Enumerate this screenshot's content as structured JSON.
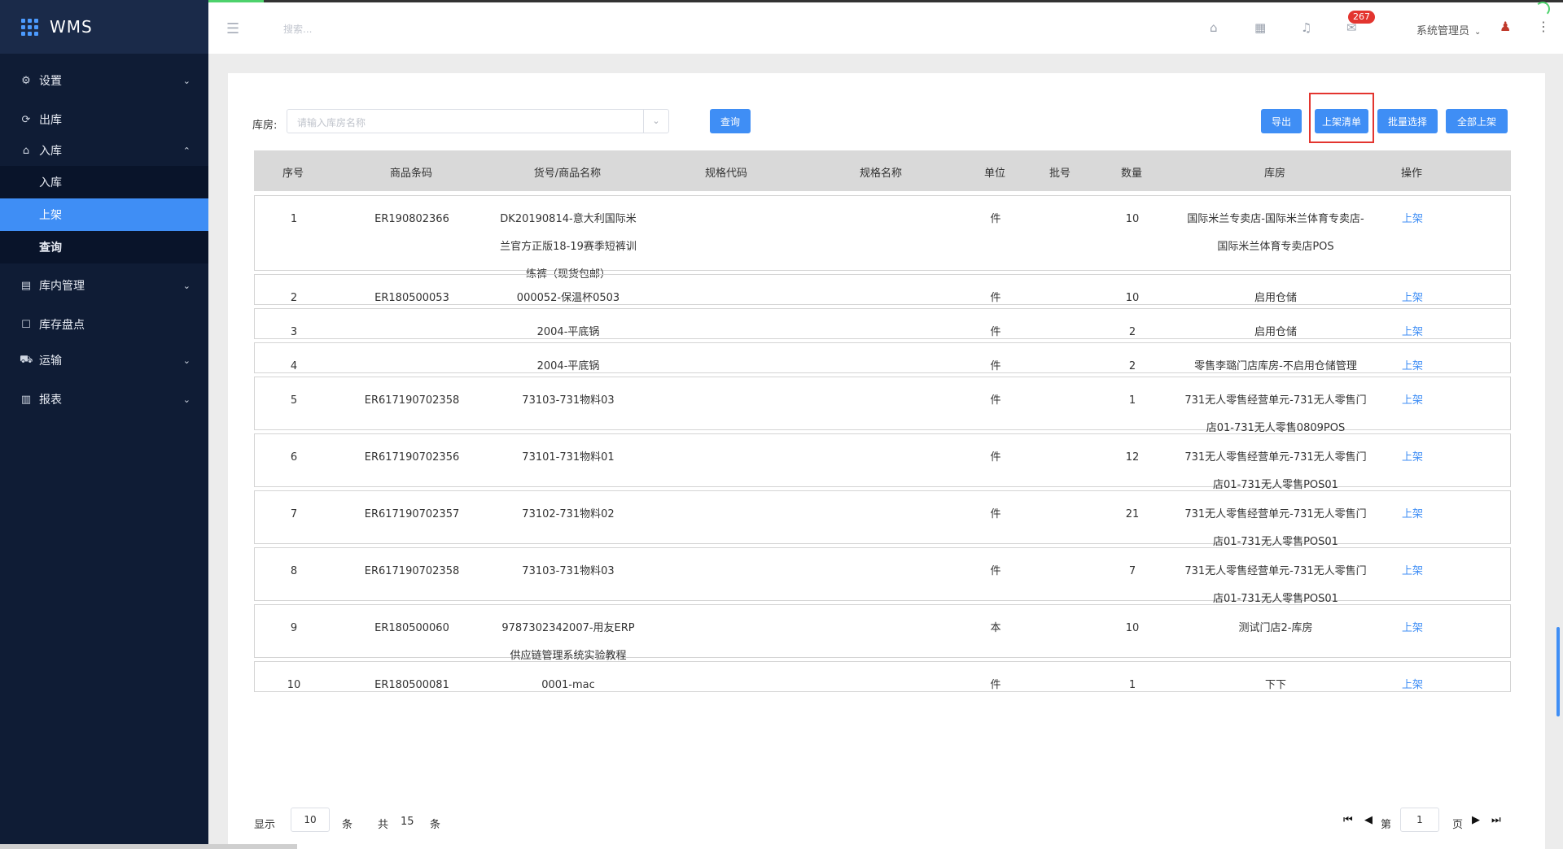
{
  "app": {
    "title": "WMS"
  },
  "sidebar": {
    "items": [
      {
        "label": "设置",
        "icon": "gear-icon",
        "expanded": false
      },
      {
        "label": "出库",
        "icon": "export-icon"
      },
      {
        "label": "入库",
        "icon": "home-icon",
        "expanded": true,
        "children": [
          {
            "label": "入库",
            "active": false
          },
          {
            "label": "上架",
            "active": true
          },
          {
            "label": "查询",
            "active": false
          }
        ]
      },
      {
        "label": "库内管理",
        "icon": "warehouse-icon",
        "expanded": false
      },
      {
        "label": "库存盘点",
        "icon": "clipboard-icon"
      },
      {
        "label": "运输",
        "icon": "truck-icon",
        "expanded": false
      },
      {
        "label": "报表",
        "icon": "chart-icon",
        "expanded": false
      }
    ]
  },
  "header": {
    "search_placeholder": "搜索...",
    "badge_count": "267",
    "user_name": "系统管理员"
  },
  "filter": {
    "label": "库房:",
    "placeholder": "请输入库房名称",
    "query_button": "查询"
  },
  "actions": {
    "export": "导出",
    "shelf_list": "上架清单",
    "batch_select": "批量选择",
    "shelve_all": "全部上架"
  },
  "table": {
    "columns": [
      "序号",
      "商品条码",
      "货号/商品名称",
      "规格代码",
      "规格名称",
      "单位",
      "批号",
      "数量",
      "库房",
      "操作"
    ],
    "rows": [
      {
        "no": "1",
        "barcode": "ER190802366",
        "name": "DK20190814-意大利国际米兰官方正版18-19赛季短裤训练裤（现货包邮）",
        "spec_code": "",
        "spec_name": "",
        "unit": "件",
        "batch": "",
        "qty": "10",
        "warehouse": "国际米兰专卖店-国际米兰体育专卖店-国际米兰体育专卖店POS",
        "op": "上架"
      },
      {
        "no": "2",
        "barcode": "ER180500053",
        "name": "000052-保温杯0503",
        "spec_code": "",
        "spec_name": "",
        "unit": "件",
        "batch": "",
        "qty": "10",
        "warehouse": "启用仓储",
        "op": "上架"
      },
      {
        "no": "3",
        "barcode": "",
        "name": "2004-平底锅",
        "spec_code": "",
        "spec_name": "",
        "unit": "件",
        "batch": "",
        "qty": "2",
        "warehouse": "启用仓储",
        "op": "上架"
      },
      {
        "no": "4",
        "barcode": "",
        "name": "2004-平底锅",
        "spec_code": "",
        "spec_name": "",
        "unit": "件",
        "batch": "",
        "qty": "2",
        "warehouse": "零售李璐门店库房-不启用仓储管理",
        "op": "上架"
      },
      {
        "no": "5",
        "barcode": "ER617190702358",
        "name": "73103-731物料03",
        "spec_code": "",
        "spec_name": "",
        "unit": "件",
        "batch": "",
        "qty": "1",
        "warehouse": "731无人零售经营单元-731无人零售门店01-731无人零售0809POS",
        "op": "上架"
      },
      {
        "no": "6",
        "barcode": "ER617190702356",
        "name": "73101-731物料01",
        "spec_code": "",
        "spec_name": "",
        "unit": "件",
        "batch": "",
        "qty": "12",
        "warehouse": "731无人零售经营单元-731无人零售门店01-731无人零售POS01",
        "op": "上架"
      },
      {
        "no": "7",
        "barcode": "ER617190702357",
        "name": "73102-731物料02",
        "spec_code": "",
        "spec_name": "",
        "unit": "件",
        "batch": "",
        "qty": "21",
        "warehouse": "731无人零售经营单元-731无人零售门店01-731无人零售POS01",
        "op": "上架"
      },
      {
        "no": "8",
        "barcode": "ER617190702358",
        "name": "73103-731物料03",
        "spec_code": "",
        "spec_name": "",
        "unit": "件",
        "batch": "",
        "qty": "7",
        "warehouse": "731无人零售经营单元-731无人零售门店01-731无人零售POS01",
        "op": "上架"
      },
      {
        "no": "9",
        "barcode": "ER180500060",
        "name": "9787302342007-用友ERP供应链管理系统实验教程",
        "spec_code": "",
        "spec_name": "",
        "unit": "本",
        "batch": "",
        "qty": "10",
        "warehouse": "测试门店2-库房",
        "op": "上架"
      },
      {
        "no": "10",
        "barcode": "ER180500081",
        "name": "0001-mac",
        "spec_code": "",
        "spec_name": "",
        "unit": "件",
        "batch": "",
        "qty": "1",
        "warehouse": "下下",
        "op": "上架"
      }
    ]
  },
  "pagination": {
    "show_label": "显示",
    "page_size": "10",
    "unit": "条",
    "total_label": "共",
    "total": "15",
    "total_unit": "条",
    "page_label": "第",
    "current_page": "1",
    "page_unit": "页"
  },
  "colors": {
    "primary": "#3f8ef5",
    "sidebar_bg": "#0f1c35",
    "badge": "#e3352f"
  }
}
